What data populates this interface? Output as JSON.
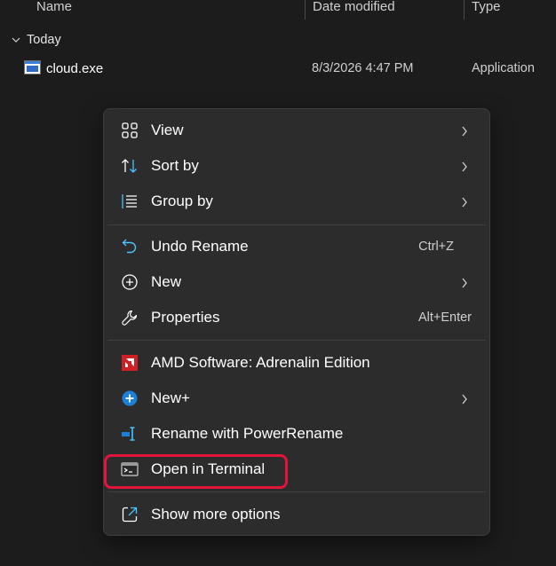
{
  "columns": {
    "name": "Name",
    "date_modified": "Date modified",
    "type": "Type"
  },
  "group": {
    "label": "Today"
  },
  "file": {
    "name": "cloud.exe",
    "date": "8/3/2026 4:47 PM",
    "type": "Application"
  },
  "menu": {
    "view": "View",
    "sort_by": "Sort by",
    "group_by": "Group by",
    "undo_rename": "Undo Rename",
    "undo_rename_shortcut": "Ctrl+Z",
    "new": "New",
    "properties": "Properties",
    "properties_shortcut": "Alt+Enter",
    "amd_software": "AMD Software: Adrenalin Edition",
    "new_plus": "New+",
    "rename_powerrename": "Rename with PowerRename",
    "open_terminal": "Open in Terminal",
    "show_more": "Show more options"
  },
  "colors": {
    "background": "#1c1c1c",
    "menu_bg": "#2c2c2c",
    "highlight_border": "#e3143a",
    "amd_red": "#d11f26",
    "new_plus_blue": "#1e7fd8",
    "accent_blue": "#4cc2ff"
  }
}
